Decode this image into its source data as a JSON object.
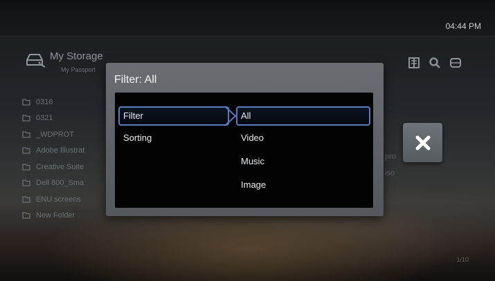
{
  "topbar": {
    "time": "04:44 PM"
  },
  "header": {
    "title": "My Storage",
    "subtitle": "My Passport"
  },
  "toolbar": {
    "icons": [
      "view-mode-icon",
      "search-icon",
      "storage-icon"
    ]
  },
  "folders": [
    {
      "name": "0316"
    },
    {
      "name": "0321"
    },
    {
      "name": "_WDPROT"
    },
    {
      "name": "Adobe Illustrat",
      "trail": "pro"
    },
    {
      "name": "Creative Suite",
      "trail": "iso"
    },
    {
      "name": "Dell 800_Sma"
    },
    {
      "name": "ENU screens"
    },
    {
      "name": "New Folder"
    }
  ],
  "close_button": {
    "icon": "close-icon"
  },
  "pagination": {
    "text": "1/10"
  },
  "dialog": {
    "title": "Filter: All",
    "menu": [
      {
        "label": "Filter",
        "selected": true
      },
      {
        "label": "Sorting",
        "selected": false
      }
    ],
    "options": [
      {
        "label": "All",
        "selected": true
      },
      {
        "label": "Video",
        "selected": false
      },
      {
        "label": "Music",
        "selected": false
      },
      {
        "label": "Image",
        "selected": false
      }
    ]
  },
  "colors": {
    "selection_border": "#5b7dbd",
    "dialog_bg": "#5f6367",
    "panel_bg": "#030303"
  }
}
